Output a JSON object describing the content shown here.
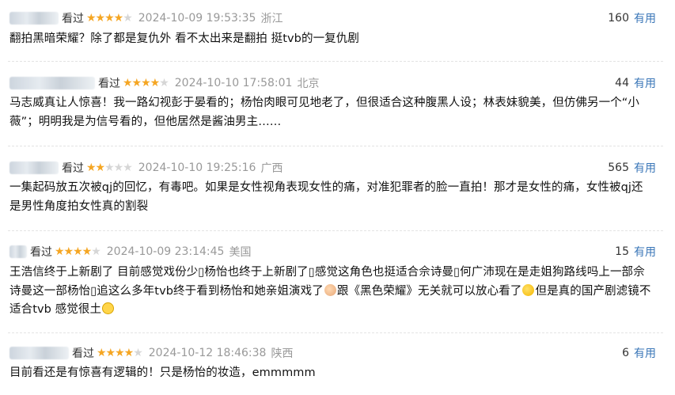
{
  "reviews": [
    {
      "status": "看过",
      "stars": "★★★★",
      "stars_off": "★",
      "time": "2024-10-09 19:53:35",
      "location": "浙江",
      "votes": "160",
      "useful": "有用",
      "text": "翻拍黑暗荣耀？除了都是复仇外 看不太出来是翻拍 挺tvb的一复仇剧"
    },
    {
      "status": "看过",
      "stars": "★★★★",
      "stars_off": "★",
      "time": "2024-10-10 17:58:01",
      "location": "北京",
      "votes": "44",
      "useful": "有用",
      "text": "马志威真让人惊喜！我一路幻视彭于晏看的；杨怡肉眼可见地老了，但很适合这种腹黑人设；林表妹貌美，但仿佛另一个“小薇”；明明我是为信号看的，但他居然是酱油男主……"
    },
    {
      "status": "看过",
      "stars": "★★",
      "stars_off": "★★★",
      "time": "2024-10-10 19:25:16",
      "location": "广西",
      "votes": "565",
      "useful": "有用",
      "text": "一集起码放五次被qj的回忆，有毒吧。如果是女性视角表现女性的痛，对准犯罪者的脸一直拍！那才是女性的痛，女性被qj还是男性角度拍女性真的割裂"
    },
    {
      "status": "看过",
      "stars": "★★★★",
      "stars_off": "★",
      "time": "2024-10-09 23:14:45",
      "location": "美国",
      "votes": "15",
      "useful": "有用",
      "text_part1": "王浩信终于上新剧了 目前感觉戏份少▯杨怡也终于上新剧了▯感觉这角色也挺适合佘诗曼▯何广沛现在是走姐狗路线吗上一部佘诗曼这一部杨怡▯追这么多年tvb终于看到杨怡和她亲姐演戏了",
      "text_part2": "跟《黑色荣耀》无关就可以放心看了",
      "text_part3": "但是真的国产剧滤镜不适合tvb 感觉很土"
    },
    {
      "status": "看过",
      "stars": "★★★★",
      "stars_off": "★",
      "time": "2024-10-12 18:46:38",
      "location": "陕西",
      "votes": "6",
      "useful": "有用",
      "text": "目前看还是有惊喜有逻辑的！只是杨怡的妆造，emmmmm"
    }
  ]
}
